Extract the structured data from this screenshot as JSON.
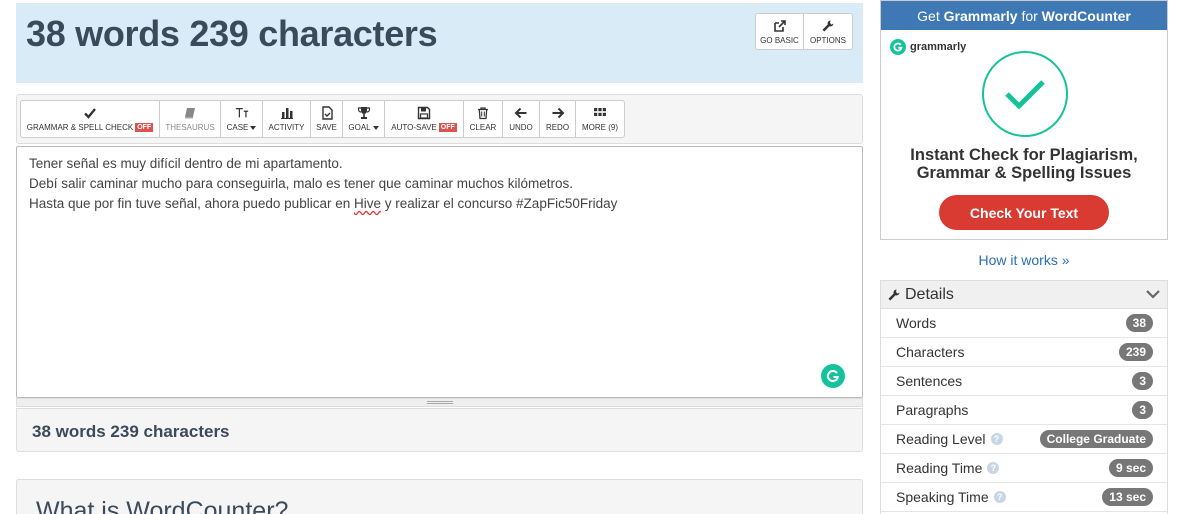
{
  "header": {
    "title": "38 words 239 characters",
    "go_basic": "GO BASIC",
    "options": "OPTIONS"
  },
  "toolbar": {
    "grammar": "GRAMMAR & SPELL CHECK",
    "grammar_state": "OFF",
    "thesaurus": "THESAURUS",
    "case": "CASE",
    "activity": "ACTIVITY",
    "save": "SAVE",
    "goal": "GOAL",
    "autosave": "AUTO-SAVE",
    "autosave_state": "OFF",
    "clear": "CLEAR",
    "undo": "UNDO",
    "redo": "REDO",
    "more": "MORE (9)"
  },
  "editor": {
    "line1": "Tener señal es muy difícil dentro de mi apartamento.",
    "line2": "Debí salir  caminar mucho para conseguirla, malo es tener que caminar muchos kilómetros.",
    "line3_pre": "Hasta que por fin tuve señal, ahora puedo publicar en ",
    "line3_flag": "Hive",
    "line3_post": " y realizar el concurso #ZapFic50Friday"
  },
  "bottom_count": "38 words 239 characters",
  "what_is_heading": "What is WordCounter?",
  "ad": {
    "top_pre": "Get ",
    "top_brand": "Grammarly",
    "top_mid": " for ",
    "top_site": "WordCounter",
    "logo_text": "grammarly",
    "headline_1": "Instant Check for Plagiarism,",
    "headline_2": "Grammar & Spelling Issues",
    "cta": "Check Your Text"
  },
  "how_it_works": "How it works »",
  "details": {
    "title": "Details",
    "rows": [
      {
        "label": "Words",
        "value": "38"
      },
      {
        "label": "Characters",
        "value": "239"
      },
      {
        "label": "Sentences",
        "value": "3"
      },
      {
        "label": "Paragraphs",
        "value": "3"
      },
      {
        "label": "Reading Level",
        "value": "College Graduate"
      },
      {
        "label": "Reading Time",
        "value": "9 sec"
      },
      {
        "label": "Speaking Time",
        "value": "13 sec"
      }
    ]
  },
  "colors": {
    "header_bg": "#d9ebf6",
    "grammarly_green": "#15c39a",
    "cta_red": "#d93a32",
    "ad_bar_blue": "#3e79b5",
    "off_red": "#d9534f",
    "badge_gray": "#777777"
  }
}
